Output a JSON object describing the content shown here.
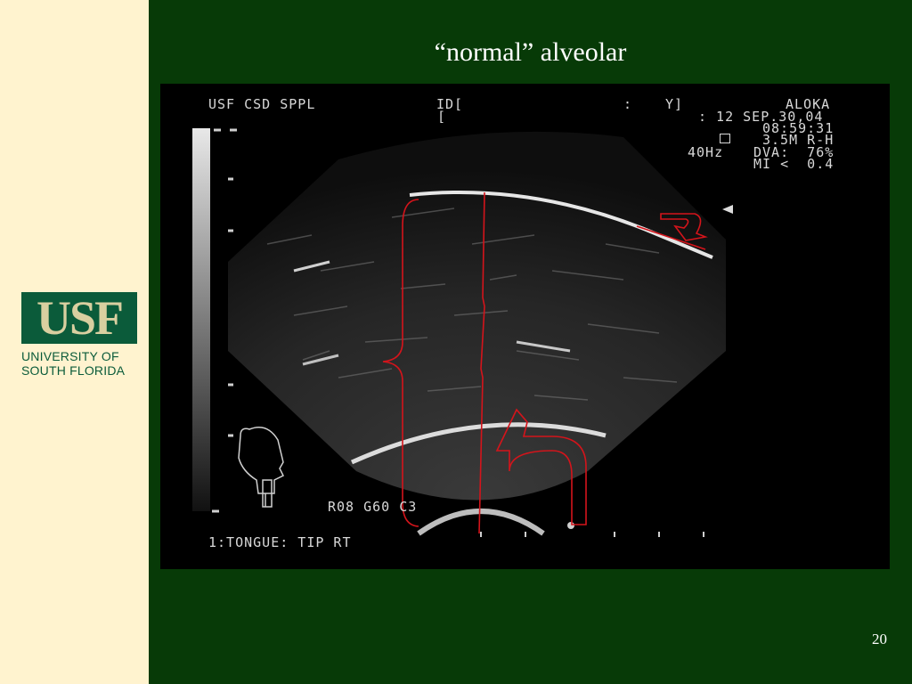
{
  "slide": {
    "title": "“normal” alveolar",
    "page_number": "20"
  },
  "logo": {
    "word": "USF",
    "line1": "UNIVERSITY OF",
    "line2": "SOUTH FLORIDA"
  },
  "ultrasound": {
    "header_left": "USF CSD SPPL",
    "id_label": "ID[",
    "id_colon": ":",
    "id_y": "Y]",
    "bracket": "[",
    "brand": "ALOKA",
    "date": ": 12 SEP.30,04",
    "time": "08:59:31",
    "probe": "3.5M R-H",
    "freq": "40Hz",
    "dva": "DVA:  76%",
    "mi": "MI <  0.4",
    "probe_icon": "probe-icon",
    "params": "R08 G60 C3",
    "caption": "1:TONGUE: TIP RT"
  },
  "colors": {
    "background": "#073a07",
    "sidebar": "#fff3cf",
    "logo_green": "#0b5b3a",
    "annotation_red": "#d4141b"
  }
}
